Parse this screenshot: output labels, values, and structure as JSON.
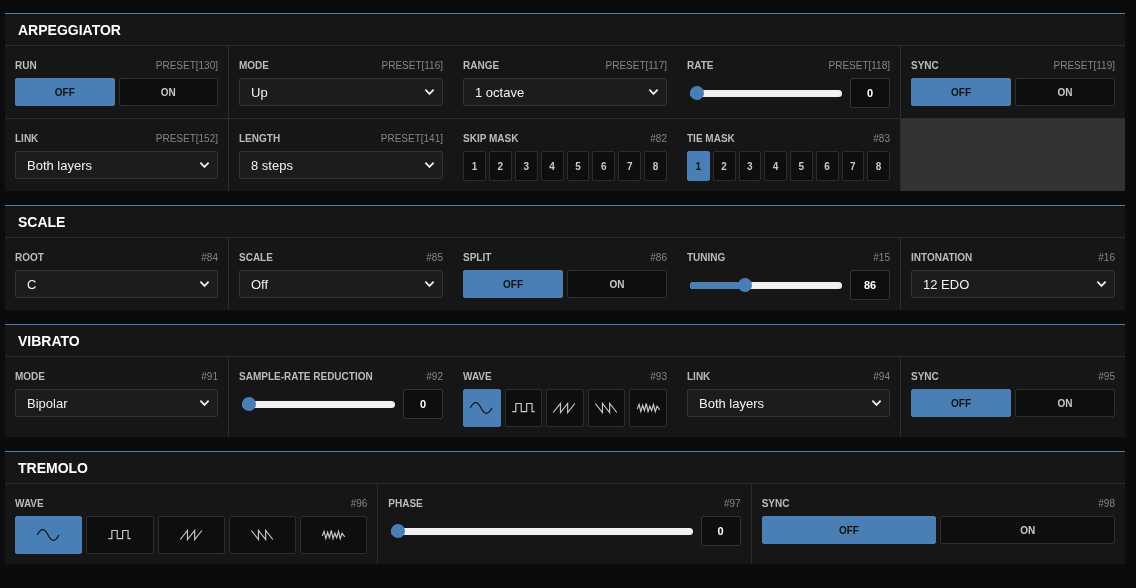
{
  "sections": [
    {
      "title": "ARPEGGIATOR",
      "cells": [
        {
          "kind": "toggle",
          "label": "RUN",
          "param": "PRESET[130]",
          "options": [
            {
              "label": "OFF",
              "selected": true
            },
            {
              "label": "ON",
              "selected": false
            }
          ]
        },
        {
          "kind": "select",
          "label": "MODE",
          "param": "PRESET[116]",
          "value": "Up"
        },
        {
          "kind": "select",
          "label": "RANGE",
          "param": "PRESET[117]",
          "value": "1 octave"
        },
        {
          "kind": "slider",
          "label": "RATE",
          "param": "PRESET[118]",
          "level": 0,
          "reading": "0"
        },
        {
          "kind": "toggle",
          "label": "SYNC",
          "param": "PRESET[119]",
          "options": [
            {
              "label": "OFF",
              "selected": true
            },
            {
              "label": "ON",
              "selected": false
            }
          ]
        },
        {
          "kind": "select",
          "label": "LINK",
          "param": "PRESET[152]",
          "value": "Both layers"
        },
        {
          "kind": "select",
          "label": "LENGTH",
          "param": "PRESET[141]",
          "value": "8 steps"
        },
        {
          "kind": "mask",
          "label": "SKIP MASK",
          "param": "#82",
          "steps": [
            {
              "label": "1",
              "selected": false
            },
            {
              "label": "2",
              "selected": false
            },
            {
              "label": "3",
              "selected": false
            },
            {
              "label": "4",
              "selected": false
            },
            {
              "label": "5",
              "selected": false
            },
            {
              "label": "6",
              "selected": false
            },
            {
              "label": "7",
              "selected": false
            },
            {
              "label": "8",
              "selected": false
            }
          ]
        },
        {
          "kind": "mask",
          "label": "TIE MASK",
          "param": "#83",
          "steps": [
            {
              "label": "1",
              "selected": true
            },
            {
              "label": "2",
              "selected": false
            },
            {
              "label": "3",
              "selected": false
            },
            {
              "label": "4",
              "selected": false
            },
            {
              "label": "5",
              "selected": false
            },
            {
              "label": "6",
              "selected": false
            },
            {
              "label": "7",
              "selected": false
            },
            {
              "label": "8",
              "selected": false
            }
          ]
        },
        {
          "kind": "empty"
        }
      ]
    },
    {
      "title": "SCALE",
      "cells": [
        {
          "kind": "select",
          "label": "ROOT",
          "param": "#84",
          "value": "C"
        },
        {
          "kind": "select",
          "label": "SCALE",
          "param": "#85",
          "value": "Off"
        },
        {
          "kind": "toggle",
          "label": "SPLIT",
          "param": "#86",
          "options": [
            {
              "label": "OFF",
              "selected": true
            },
            {
              "label": "ON",
              "selected": false
            }
          ]
        },
        {
          "kind": "slider",
          "label": "TUNING",
          "param": "#15",
          "level": 0.35,
          "reading": "86"
        },
        {
          "kind": "select",
          "label": "INTONATION",
          "param": "#16",
          "value": "12 EDO"
        }
      ]
    },
    {
      "title": "VIBRATO",
      "cells": [
        {
          "kind": "select",
          "label": "MODE",
          "param": "#91",
          "value": "Bipolar"
        },
        {
          "kind": "slider",
          "label": "SAMPLE-RATE REDUCTION",
          "param": "#92",
          "level": 0,
          "reading": "0"
        },
        {
          "kind": "wave",
          "label": "WAVE",
          "param": "#93",
          "shapes": [
            {
              "kind": "sine",
              "selected": true
            },
            {
              "kind": "square",
              "selected": false
            },
            {
              "kind": "saw",
              "selected": false
            },
            {
              "kind": "ramp",
              "selected": false
            },
            {
              "kind": "noise",
              "selected": false
            }
          ]
        },
        {
          "kind": "select",
          "label": "LINK",
          "param": "#94",
          "value": "Both layers"
        },
        {
          "kind": "toggle",
          "label": "SYNC",
          "param": "#95",
          "options": [
            {
              "label": "OFF",
              "selected": true
            },
            {
              "label": "ON",
              "selected": false
            }
          ]
        }
      ]
    },
    {
      "title": "TREMOLO",
      "cells": [
        {
          "kind": "wave",
          "label": "WAVE",
          "param": "#96",
          "shapes": [
            {
              "kind": "sine",
              "selected": true
            },
            {
              "kind": "square",
              "selected": false
            },
            {
              "kind": "saw",
              "selected": false
            },
            {
              "kind": "ramp",
              "selected": false
            },
            {
              "kind": "noise",
              "selected": false
            }
          ]
        },
        {
          "kind": "slider",
          "label": "PHASE",
          "param": "#97",
          "level": 0,
          "reading": "0"
        },
        {
          "kind": "toggle",
          "label": "SYNC",
          "param": "#98",
          "options": [
            {
              "label": "OFF",
              "selected": true
            },
            {
              "label": "ON",
              "selected": false
            }
          ]
        }
      ]
    }
  ]
}
